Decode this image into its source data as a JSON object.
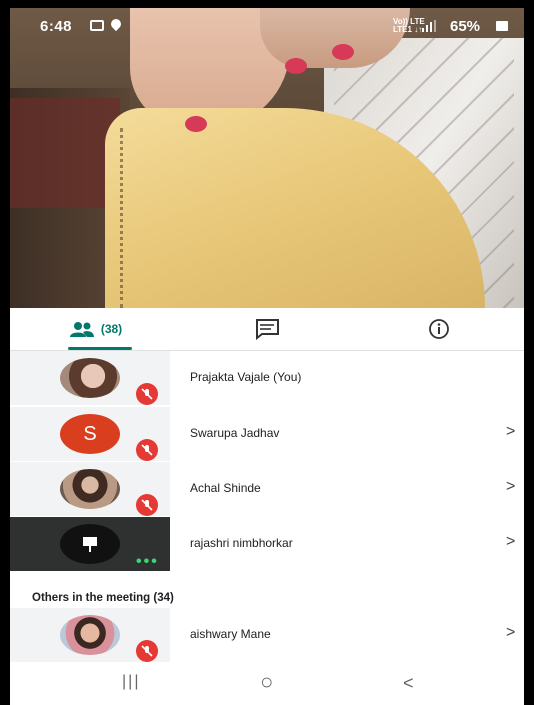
{
  "status_bar": {
    "time": "6:48",
    "network_top": "Vo)) LTE",
    "network_bottom": "LTE1 ↓↑",
    "battery_percent": "65%"
  },
  "tabs": [
    {
      "icon": "people-icon",
      "label": "(38)"
    },
    {
      "icon": "chat-icon",
      "label": ""
    },
    {
      "icon": "info-icon",
      "label": ""
    }
  ],
  "participants": [
    {
      "name": "Prajakta Vajale (You)",
      "muted": true,
      "has_chevron": false
    },
    {
      "name": "Swarupa Jadhav",
      "initial": "S",
      "muted": true,
      "has_chevron": true
    },
    {
      "name": "Achal Shinde",
      "muted": true,
      "has_chevron": true
    },
    {
      "name": "rajashri nimbhorkar",
      "presenting": true,
      "has_chevron": true
    }
  ],
  "others_section": {
    "title": "Others in the meeting (34)"
  },
  "others": [
    {
      "name": "aishwary Mane",
      "muted": true,
      "has_chevron": true
    }
  ],
  "nav": {
    "recent": "|||",
    "home": "○",
    "back": "<"
  },
  "colors": {
    "accent": "#00796b",
    "mute_red": "#e53935",
    "avatar_s": "#d93f1f"
  }
}
